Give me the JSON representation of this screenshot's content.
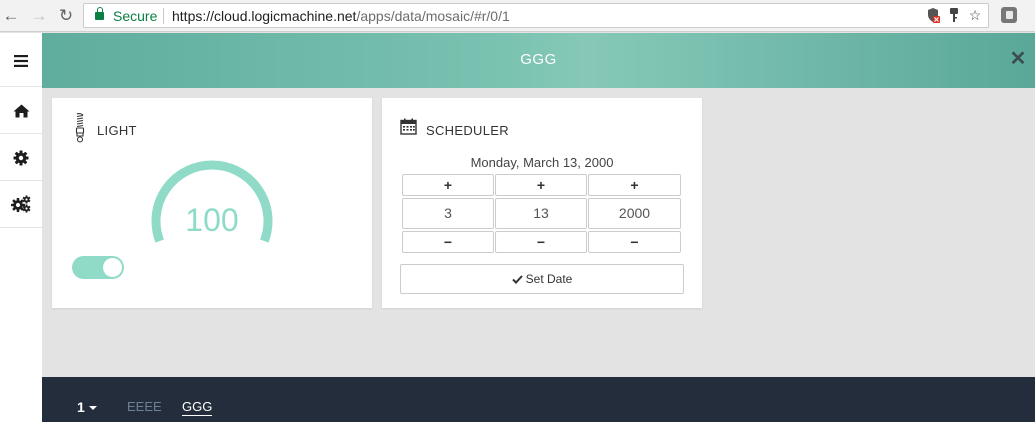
{
  "browser": {
    "secure_label": "Secure",
    "url_host": "https://cloud.logicmachine.net",
    "url_path": "/apps/data/mosaic/#r/0/1"
  },
  "header": {
    "title": "GGG"
  },
  "light_card": {
    "title": "LIGHT",
    "value": "100",
    "level_percent": 100,
    "toggle_on": true
  },
  "scheduler_card": {
    "title": "SCHEDULER",
    "date_text": "Monday, March 13, 2000",
    "plus": "+",
    "minus": "−",
    "month": "3",
    "day": "13",
    "year": "2000",
    "set_date_label": "Set Date"
  },
  "footer": {
    "page_selector": "1",
    "tabs": [
      {
        "label": "EEEE",
        "active": false
      },
      {
        "label": "GGG",
        "active": true
      }
    ]
  },
  "colors": {
    "accent": "#8fdbc8",
    "header": "#79c1b0",
    "footer": "#232d3b",
    "secure": "#0b8043"
  },
  "icons": [
    "back-icon",
    "forward-icon",
    "reload-icon",
    "lock-icon",
    "menu-icon",
    "home-icon",
    "gear-icon",
    "gears-icon",
    "close-icon",
    "bulb-icon",
    "calendar-icon",
    "check-icon"
  ]
}
